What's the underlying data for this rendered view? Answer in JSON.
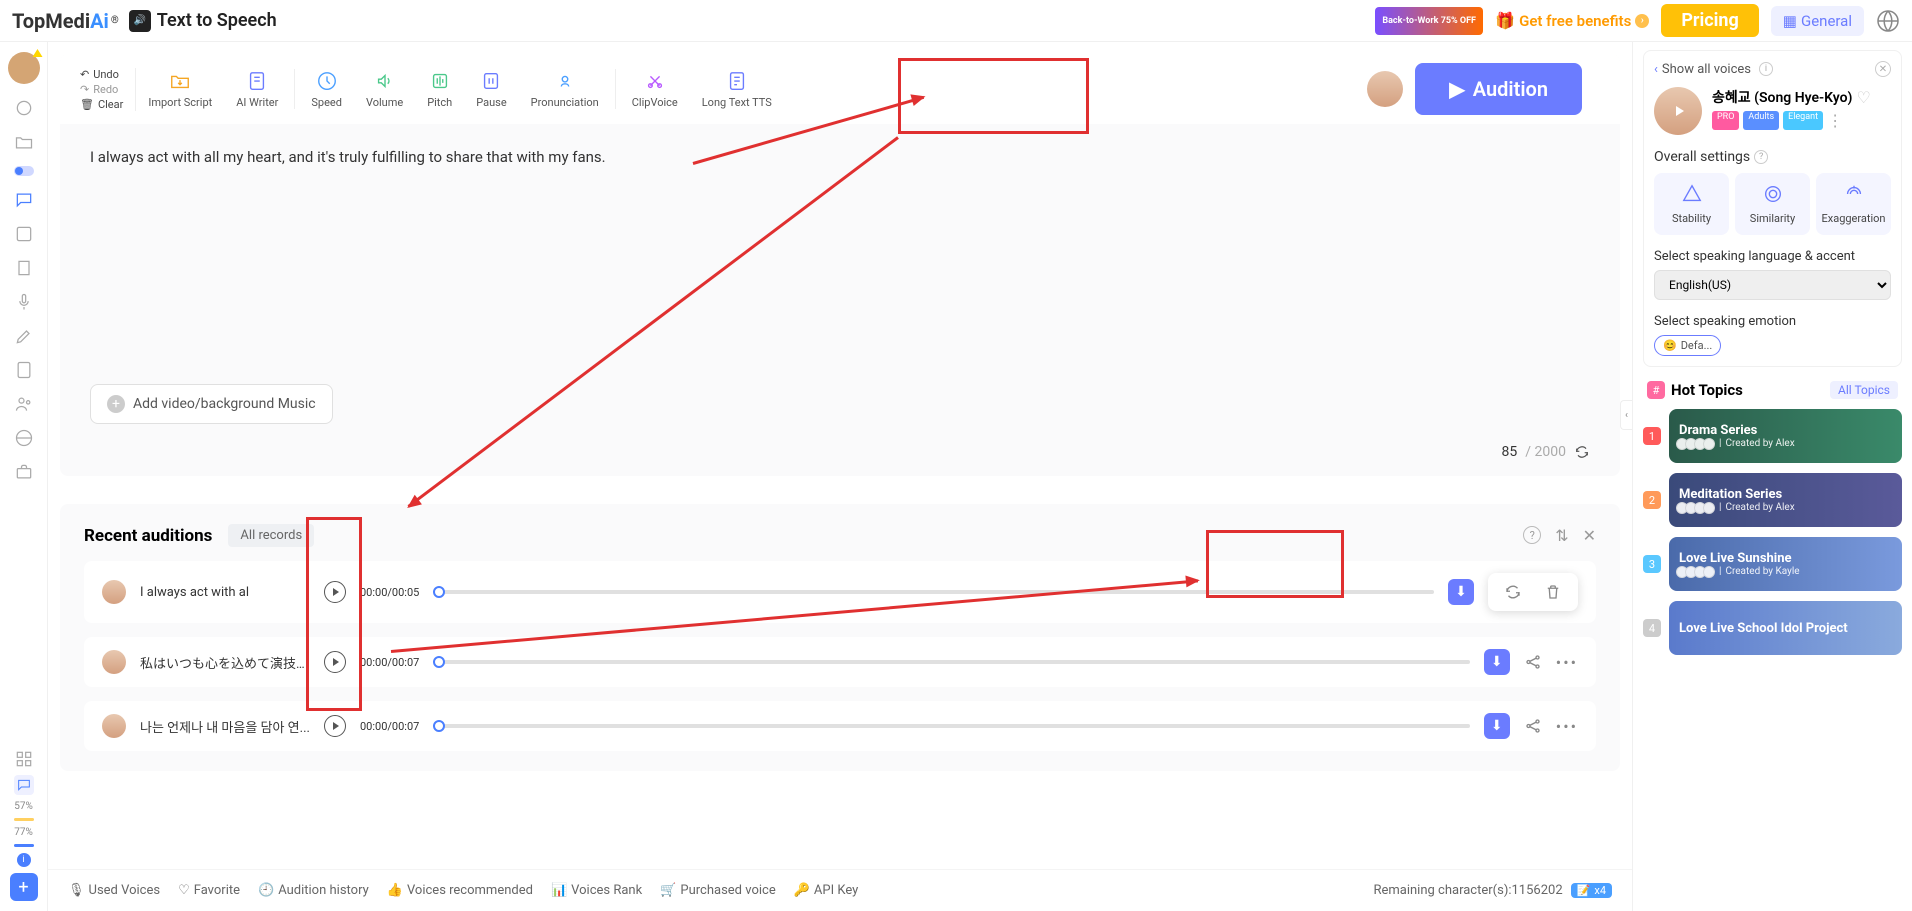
{
  "header": {
    "logo_main": "TopMedi",
    "logo_ai": "Ai",
    "logo_sup": "®",
    "page_title": "Text to Speech",
    "promo": "Back-to-Work 75% OFF",
    "free_benefits": "Get free benefits",
    "pricing": "Pricing",
    "general": "General"
  },
  "sidebar": {
    "percent1": "57%",
    "percent2": "77%"
  },
  "toolbar": {
    "undo": "Undo",
    "redo": "Redo",
    "clear": "Clear",
    "import_script": "Import Script",
    "ai_writer": "AI Writer",
    "speed": "Speed",
    "volume": "Volume",
    "pitch": "Pitch",
    "pause": "Pause",
    "pronunciation": "Pronunciation",
    "clip_voice": "ClipVoice",
    "long_text": "Long Text TTS",
    "audition": "Audition"
  },
  "editor": {
    "text": "I always act with all my heart, and it's truly fulfilling to share that with my fans.",
    "add_media": "Add video/background Music",
    "char_count": "85",
    "char_total": "/ 2000"
  },
  "recent": {
    "title": "Recent auditions",
    "tab": "All records",
    "rows": [
      {
        "text": "I always act with al",
        "time": "00:00/00:05"
      },
      {
        "text": "私はいつも心を込めて演技を...",
        "time": "00:00/00:07"
      },
      {
        "text": "나는 언제나 내 마음을 담아 연...",
        "time": "00:00/00:07"
      }
    ]
  },
  "bottom": {
    "used_voices": "Used Voices",
    "favorite": "Favorite",
    "audition_history": "Audition history",
    "voices_recommended": "Voices recommended",
    "voices_rank": "Voices Rank",
    "purchased_voice": "Purchased voice",
    "api_key": "API Key",
    "remaining": "Remaining character(s):1156202",
    "x4": "x4"
  },
  "right": {
    "show_all": "Show all voices",
    "voice_name": "송혜교 (Song Hye-Kyo)",
    "badge_pro": "PRO",
    "badge_adults": "Adults",
    "badge_elegant": "Elegant",
    "overall_settings": "Overall settings",
    "stability": "Stability",
    "similarity": "Similarity",
    "exaggeration": "Exaggeration",
    "lang_label": "Select speaking language & accent",
    "lang_value": "English(US)",
    "emotion_label": "Select speaking emotion",
    "emotion_value": "Defa...",
    "hot_topics": "Hot Topics",
    "all_topics": "All Topics",
    "topics": [
      {
        "title": "Drama Series",
        "by": "Created by Alex"
      },
      {
        "title": "Meditation Series",
        "by": "Created by Alex"
      },
      {
        "title": "Love Live Sunshine",
        "by": "Created by Kayle"
      },
      {
        "title": "Love Live School Idol Project",
        "by": ""
      }
    ]
  }
}
